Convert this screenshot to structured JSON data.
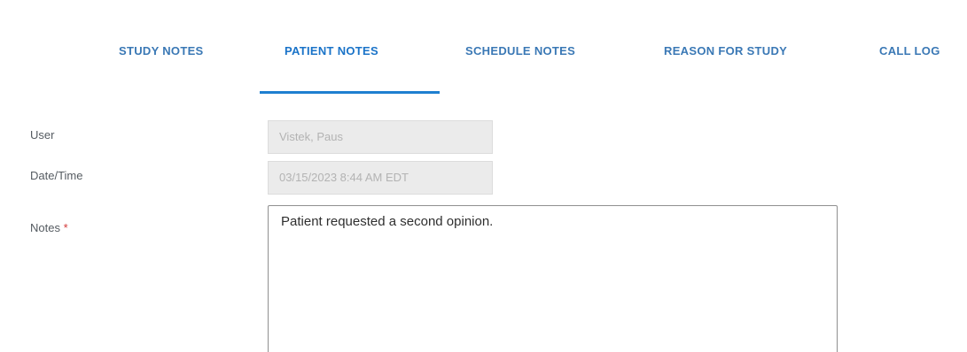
{
  "tabs": [
    {
      "label": "STUDY NOTES",
      "active": false
    },
    {
      "label": "PATIENT NOTES",
      "active": true
    },
    {
      "label": "SCHEDULE NOTES",
      "active": false
    },
    {
      "label": "REASON FOR STUDY",
      "active": false
    },
    {
      "label": "CALL LOG",
      "active": false
    }
  ],
  "form": {
    "user": {
      "label": "User",
      "value": "Vistek, Paus"
    },
    "datetime": {
      "label": "Date/Time",
      "value": "03/15/2023 8:44 AM EDT"
    },
    "notes": {
      "label": "Notes",
      "required_mark": "*",
      "value": "Patient requested a second opinion."
    }
  },
  "colors": {
    "tab_text": "#3a78b5",
    "tab_active_indicator": "#1e7fd0",
    "required": "#d23a3a",
    "readonly_bg": "#ebebeb"
  }
}
